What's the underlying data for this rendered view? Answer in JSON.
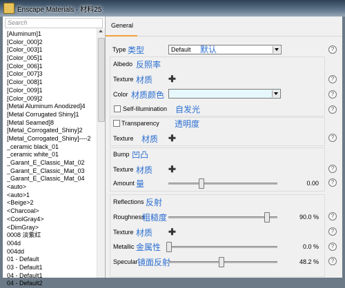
{
  "window": {
    "title": "Enscape Materials - 材料25",
    "app_icon": "enscape-icon"
  },
  "search": {
    "placeholder": "Search"
  },
  "materials": [
    "[Aluminum]1",
    "[Color_000]2",
    "[Color_003]1",
    "[Color_005]1",
    "[Color_006]1",
    "[Color_007]3",
    "[Color_008]1",
    "[Color_009]1",
    "[Color_009]2",
    "[Metal Aluminum Anodized]4",
    "[Metal Corrugated Shiny]1",
    "[Metal Seamed]8",
    "[Metal_Corrogated_Shiny]2",
    "[Metal_Corrogated_Shiny]----2",
    "_ceramic black_01",
    "_ceramic white_01",
    "_Garant_E_Classic_Mat_02",
    "_Garant_E_Classic_Mat_03",
    "_Garant_E_Classic_Mat_04",
    "<auto>",
    "<auto>1",
    "<Beige>2",
    "<Charcoal>",
    "<CoolGray4>",
    "<DimGray>",
    "0008 淡紫红",
    "004d",
    "004dd",
    "01 - Default",
    "03 - Default1",
    "04 - Default1",
    "04 - Default2"
  ],
  "tabs": {
    "general": "General"
  },
  "type": {
    "label": "Type",
    "cn": "类型",
    "value": "Default",
    "value_cn": "默认"
  },
  "albedo": {
    "header": "Albedo",
    "header_cn": "反照率",
    "texture_label": "Texture",
    "texture_cn": "材质",
    "color_label": "Color",
    "color_cn": "材质颜色",
    "color_value": "#e6f8fb"
  },
  "self_illumination": {
    "label": "Self-Illumination",
    "cn": "自发光",
    "checked": false
  },
  "transparency": {
    "label": "Transparency",
    "cn": "透明度",
    "checked": false,
    "texture_label": "Texture",
    "texture_cn": "材质"
  },
  "bump": {
    "header": "Bump",
    "header_cn": "凹凸",
    "texture_label": "Texture",
    "texture_cn": "材质",
    "amount_label": "Amount",
    "amount_cn": "量",
    "amount_value": "0.00",
    "amount_fraction": 0.3
  },
  "reflections": {
    "header": "Reflections",
    "header_cn": "反射",
    "roughness_label": "Roughness",
    "roughness_cn": "粗糙度",
    "roughness_value": "90.0 %",
    "roughness_fraction": 0.9,
    "texture_label": "Texture",
    "texture_cn": "材质",
    "metallic_label": "Metallic",
    "metallic_cn": "金属性",
    "metallic_value": "0.0 %",
    "metallic_fraction": 0.0,
    "specular_label": "Specular",
    "specular_cn": "镜面反射",
    "specular_value": "48.2 %",
    "specular_fraction": 0.482
  },
  "help_glyph": "?",
  "plus_glyph": "✚"
}
